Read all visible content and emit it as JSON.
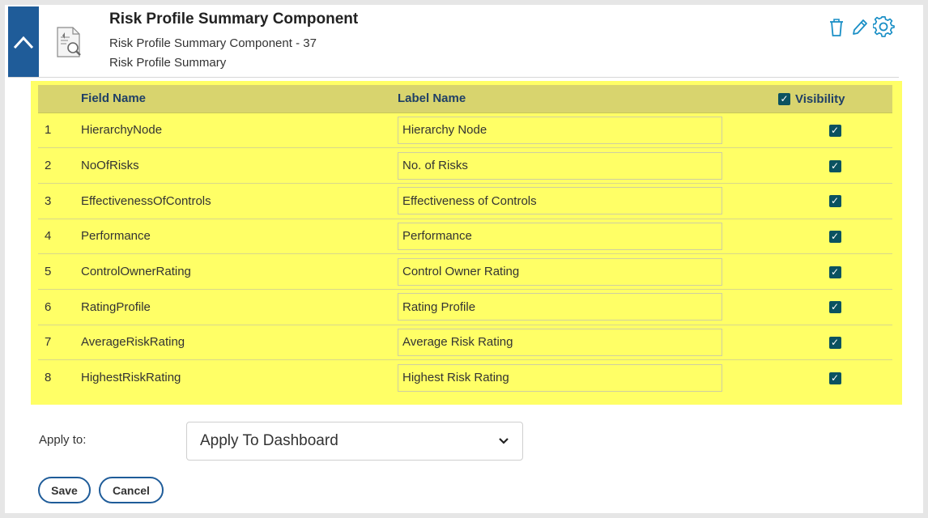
{
  "header": {
    "title": "Risk Profile Summary Component",
    "subtitle": "Risk Profile Summary Component - 37",
    "subtitle2": "Risk Profile Summary"
  },
  "table": {
    "headers": {
      "field_name": "Field Name",
      "label_name": "Label Name",
      "visibility": "Visibility"
    },
    "rows": [
      {
        "num": "1",
        "field": "HierarchyNode",
        "label": "Hierarchy Node",
        "visible": true
      },
      {
        "num": "2",
        "field": "NoOfRisks",
        "label": "No. of Risks",
        "visible": true
      },
      {
        "num": "3",
        "field": "EffectivenessOfControls",
        "label": "Effectiveness of Controls",
        "visible": true
      },
      {
        "num": "4",
        "field": "Performance",
        "label": "Performance",
        "visible": true
      },
      {
        "num": "5",
        "field": "ControlOwnerRating",
        "label": "Control Owner Rating",
        "visible": true
      },
      {
        "num": "6",
        "field": "RatingProfile",
        "label": "Rating Profile",
        "visible": true
      },
      {
        "num": "7",
        "field": "AverageRiskRating",
        "label": "Average Risk Rating",
        "visible": true
      },
      {
        "num": "8",
        "field": "HighestRiskRating",
        "label": "Highest Risk Rating",
        "visible": true
      }
    ]
  },
  "apply": {
    "label": "Apply to:",
    "selected": "Apply To Dashboard"
  },
  "buttons": {
    "save": "Save",
    "cancel": "Cancel"
  },
  "colors": {
    "accent": "#1f5c99",
    "highlight": "#ffff66",
    "header_row": "#d8d46e",
    "checkbox": "#0b5260"
  },
  "icons": [
    "chevron-up-icon",
    "document-search-icon",
    "trash-icon",
    "pencil-icon",
    "gear-icon",
    "checkbox-checked-icon",
    "chevron-down-icon"
  ]
}
